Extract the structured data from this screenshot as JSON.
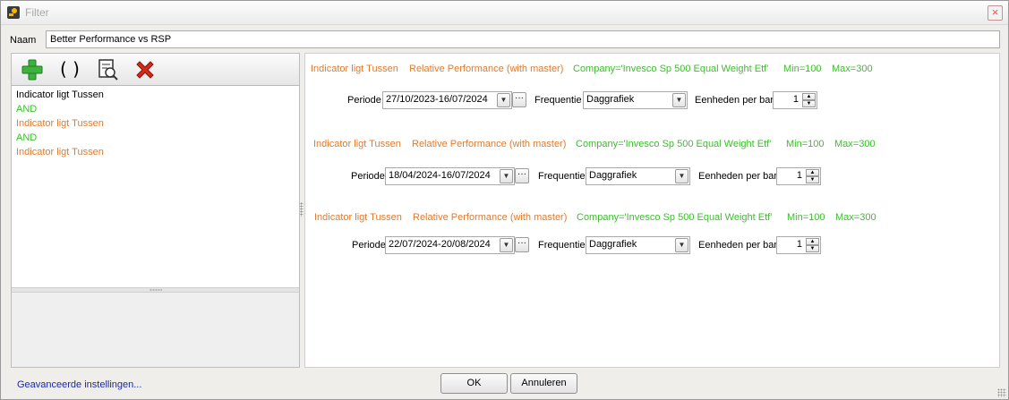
{
  "window": {
    "title": "Filter",
    "close_icon": "×"
  },
  "naam": {
    "label": "Naam",
    "value": "Better Performance vs RSP"
  },
  "toolbar": {
    "add_icon": "add-plus-icon",
    "group_icon": "( )",
    "inspect_icon": "document-search-icon",
    "delete_icon": "delete-x-icon"
  },
  "tree": {
    "items": [
      {
        "label": "Indicator ligt Tussen",
        "color": "#000000"
      },
      {
        "label": "AND",
        "color": "#3bbf2b"
      },
      {
        "label": "Indicator ligt Tussen",
        "color": "#e07b2e"
      },
      {
        "label": "AND",
        "color": "#3bbf2b"
      },
      {
        "label": "Indicator ligt Tussen",
        "color": "#e07b2e"
      }
    ]
  },
  "conditions": [
    {
      "type": "Indicator ligt Tussen",
      "indicator": "Relative Performance (with master)",
      "company": "Company='Invesco Sp 500 Equal Weight Etf'",
      "min": "Min=100",
      "max": "Max=300",
      "periode_label": "Periode",
      "periode": "27/10/2023-16/07/2024",
      "frequentie_label": "Frequentie",
      "frequentie": "Daggrafiek",
      "eenheden_label": "Eenheden per bar",
      "eenheden": "1"
    },
    {
      "type": "Indicator ligt Tussen",
      "indicator": "Relative Performance (with master)",
      "company": "Company='Invesco Sp 500 Equal Weight Etf'",
      "min": "Min=100",
      "max": "Max=300",
      "periode_label": "Periode",
      "periode": "18/04/2024-16/07/2024",
      "frequentie_label": "Frequentie",
      "frequentie": "Daggrafiek",
      "eenheden_label": "Eenheden per bar",
      "eenheden": "1"
    },
    {
      "type": "Indicator ligt Tussen",
      "indicator": "Relative Performance (with master)",
      "company": "Company='Invesco Sp 500 Equal Weight Etf'",
      "min": "Min=100",
      "max": "Max=300",
      "periode_label": "Periode",
      "periode": "22/07/2024-20/08/2024",
      "frequentie_label": "Frequentie",
      "frequentie": "Daggrafiek",
      "eenheden_label": "Eenheden per bar",
      "eenheden": "1"
    }
  ],
  "footer": {
    "advanced_link": "Geavanceerde instellingen...",
    "ok": "OK",
    "cancel": "Annuleren"
  },
  "colors": {
    "orange": "#e07b2e",
    "green": "#3bbf2b",
    "link": "#1a2aa3"
  }
}
